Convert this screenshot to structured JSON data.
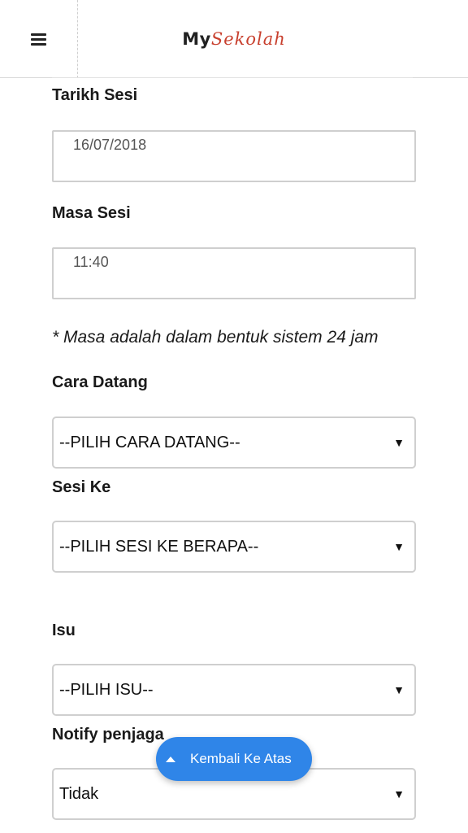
{
  "header": {
    "menu_icon": "hamburger-icon",
    "brand_part1": "My",
    "brand_part2": "Sekolah",
    "brand_color_accent": "#c8402e"
  },
  "form": {
    "tarikh_label": "Tarikh Sesi",
    "tarikh_value": "16/07/2018",
    "masa_label": "Masa Sesi",
    "masa_value": "11:40",
    "masa_note": "* Masa adalah dalam bentuk sistem 24 jam",
    "cara_label": "Cara Datang",
    "cara_value": "--PILIH CARA DATANG--",
    "sesi_label": "Sesi Ke",
    "sesi_value": "--PILIH SESI KE BERAPA--",
    "isu_label": "Isu",
    "isu_value": "--PILIH ISU--",
    "notify_label": "Notify penjaga",
    "notify_value": "Tidak",
    "caret": "▼"
  },
  "back_to_top": {
    "label": "Kembali Ke Atas",
    "color": "#2f85e8",
    "icon": "arrow-up-icon"
  }
}
